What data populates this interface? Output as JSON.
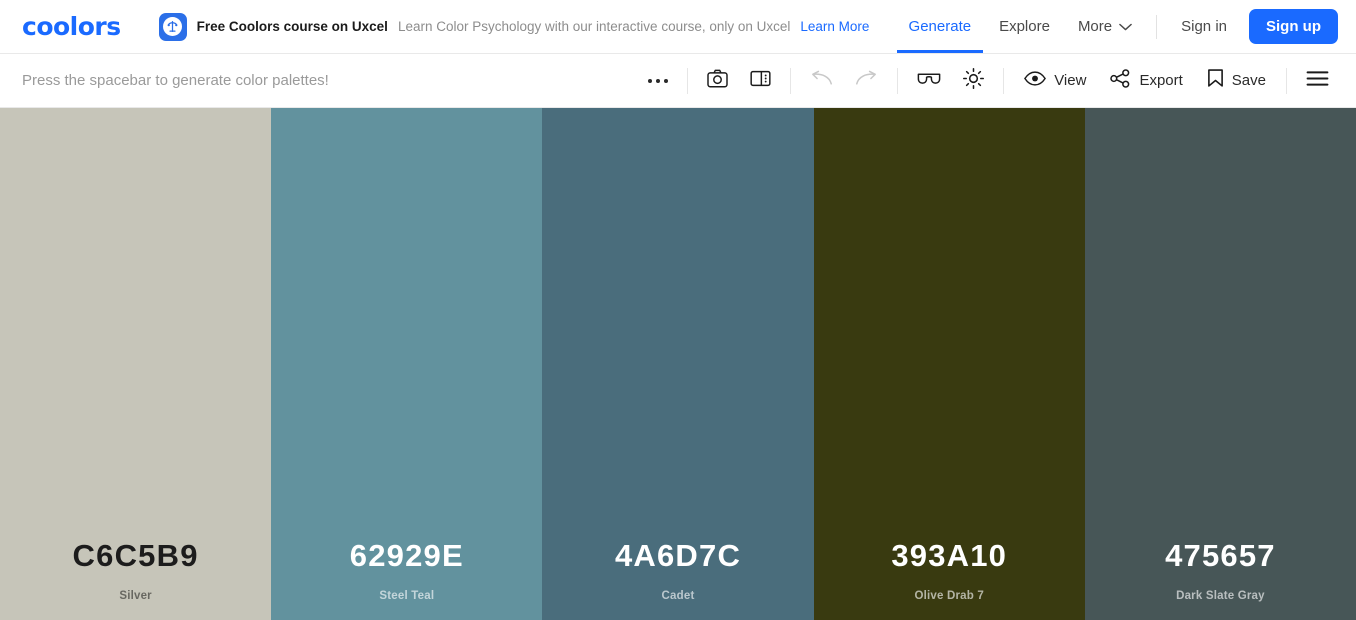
{
  "header": {
    "logo": "coolors",
    "promo": {
      "icon": "uxcel-logo-icon",
      "title": "Free Coolors course on Uxcel",
      "subtitle": "Learn Color Psychology with our interactive course, only on Uxcel",
      "link": "Learn More"
    },
    "nav": [
      {
        "label": "Generate",
        "active": true
      },
      {
        "label": "Explore",
        "active": false
      },
      {
        "label": "More",
        "active": false
      }
    ],
    "sign_in": "Sign in",
    "sign_up": "Sign up",
    "accent_color": "#1a6aff"
  },
  "toolbar": {
    "hint": "Press the spacebar to generate color palettes!",
    "items": [
      {
        "name": "more-options",
        "icon": "ellipsis-icon",
        "label": ""
      },
      {
        "name": "screenshot",
        "icon": "camera-icon",
        "label": ""
      },
      {
        "name": "layout",
        "icon": "panel-layout-icon",
        "label": ""
      },
      {
        "name": "undo",
        "icon": "undo-icon",
        "label": "",
        "disabled": true
      },
      {
        "name": "redo",
        "icon": "redo-icon",
        "label": "",
        "disabled": true
      },
      {
        "name": "color-blindness",
        "icon": "glasses-icon",
        "label": ""
      },
      {
        "name": "adjust",
        "icon": "brightness-icon",
        "label": ""
      },
      {
        "name": "view",
        "icon": "eye-icon",
        "label": "View"
      },
      {
        "name": "export",
        "icon": "share-icon",
        "label": "Export"
      },
      {
        "name": "save",
        "icon": "bookmark-icon",
        "label": "Save"
      },
      {
        "name": "menu",
        "icon": "hamburger-icon",
        "label": ""
      }
    ],
    "view_label": "View",
    "export_label": "Export",
    "save_label": "Save"
  },
  "palette": {
    "swatches": [
      {
        "hex": "C6C5B9",
        "color": "#c6c5b9",
        "name": "Silver",
        "text": "dark"
      },
      {
        "hex": "62929E",
        "color": "#62929e",
        "name": "Steel Teal",
        "text": "light"
      },
      {
        "hex": "4A6D7C",
        "color": "#4a6d7c",
        "name": "Cadet",
        "text": "light"
      },
      {
        "hex": "393A10",
        "color": "#393a10",
        "name": "Olive Drab 7",
        "text": "light"
      },
      {
        "hex": "475657",
        "color": "#475657",
        "name": "Dark Slate Gray",
        "text": "light"
      }
    ]
  }
}
